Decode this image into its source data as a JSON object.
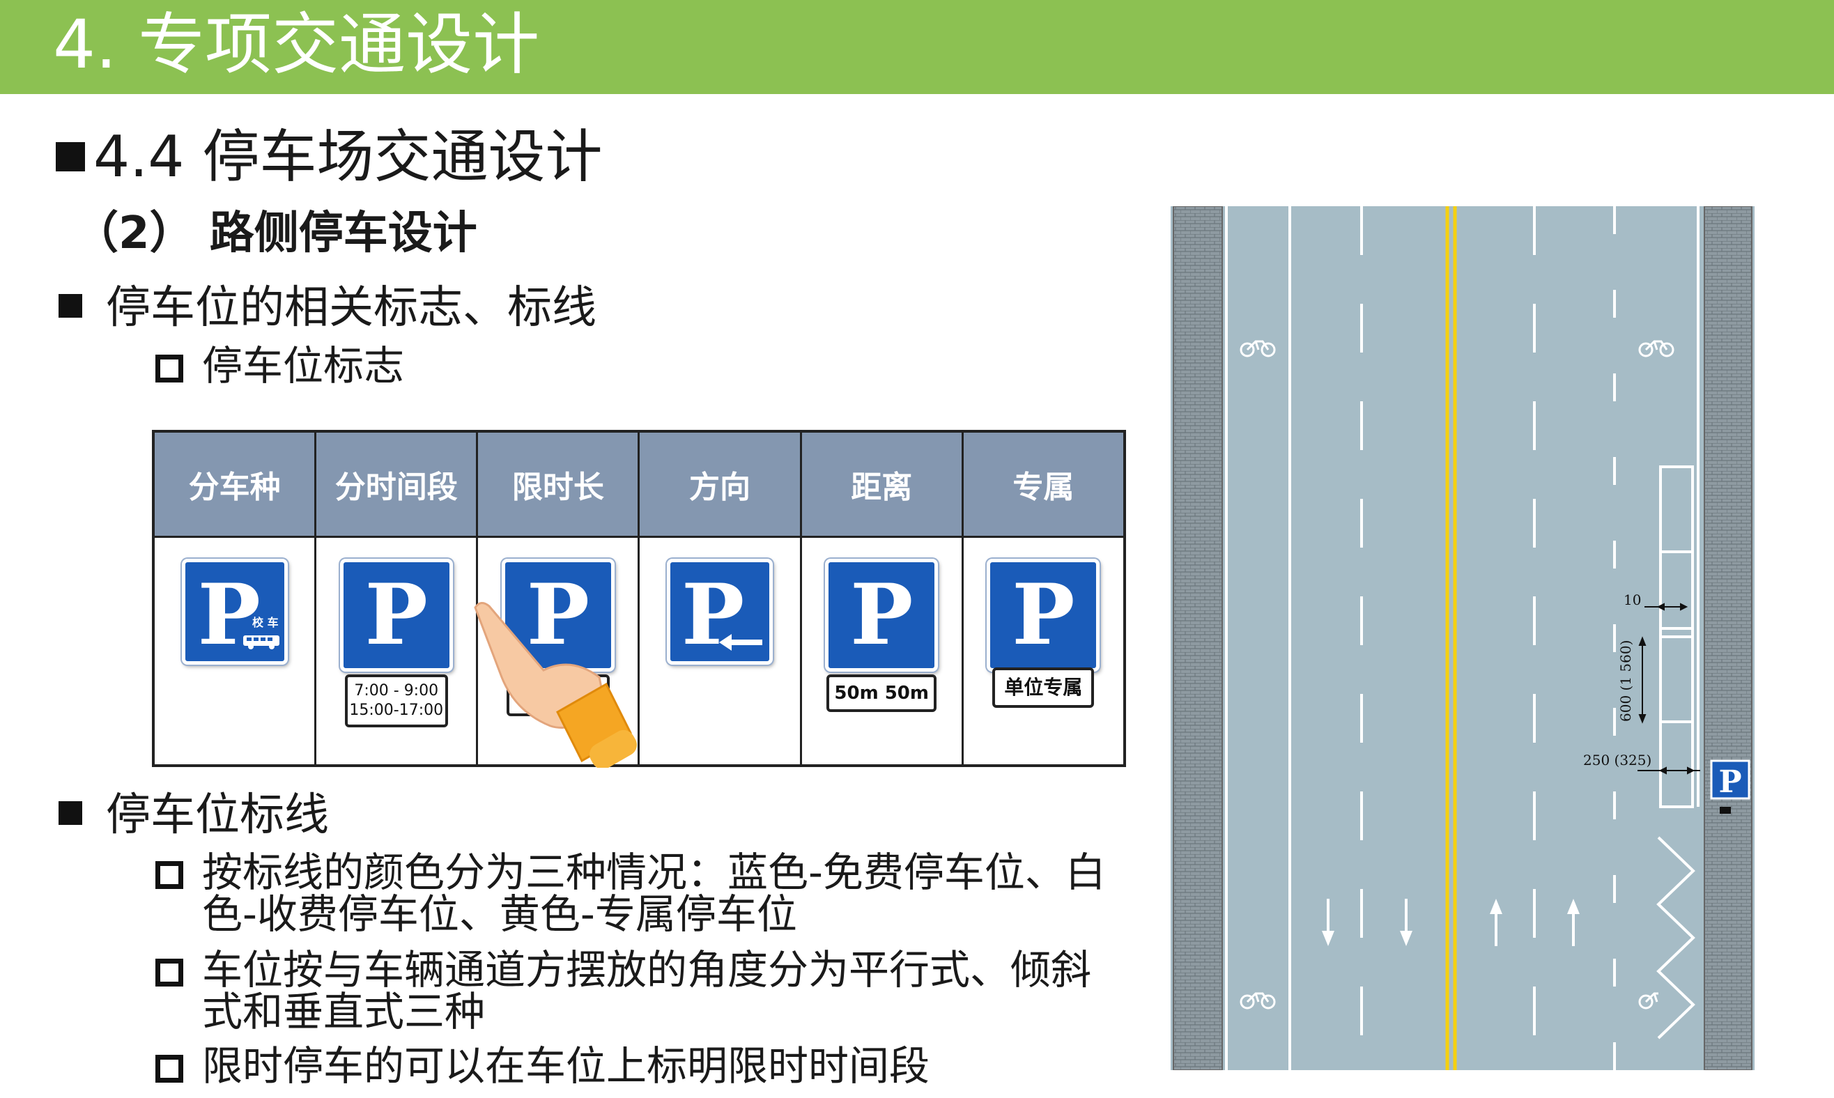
{
  "header": {
    "title": "4. 专项交通设计"
  },
  "section": {
    "title": "4.4 停车场交通设计",
    "subtitle": "（2）  路侧停车设计"
  },
  "bullets": {
    "signs_heading": "停车位的相关标志、标线",
    "signs_sub": "停车位标志",
    "lines_heading": "停车位标线",
    "lines_items": [
      "按标线的颜色分为三种情况：蓝色-免费停车位、白色-收费停车位、黄色-专属停车位",
      "车位按与车辆通道方摆放的角度分为平行式、倾斜式和垂直式三种",
      "限时停车的可以在车位上标明限时时间段"
    ]
  },
  "sign_table": {
    "headers": [
      "分车种",
      "分时间段",
      "限时长",
      "方向",
      "距离",
      "专属"
    ],
    "sign_letter": "P",
    "vehicle_label": "校 车",
    "time_plate": [
      "7:00 - 9:00",
      "15:00-17:00"
    ],
    "distance_plate": "50m 50m",
    "exclusive_plate": "单位专属"
  },
  "diagram": {
    "dim_10": "10",
    "dim_600": "600 (1 560)",
    "dim_250": "250 (325)",
    "sign_letter": "P",
    "colors": {
      "road": "#a6bcc6",
      "sidewalk": "#8e9aa1",
      "centerline": "#f5d010"
    }
  },
  "colors": {
    "header": "#8cc152",
    "table_header": "#8497b0",
    "sign_blue": "#1a5bb8"
  }
}
